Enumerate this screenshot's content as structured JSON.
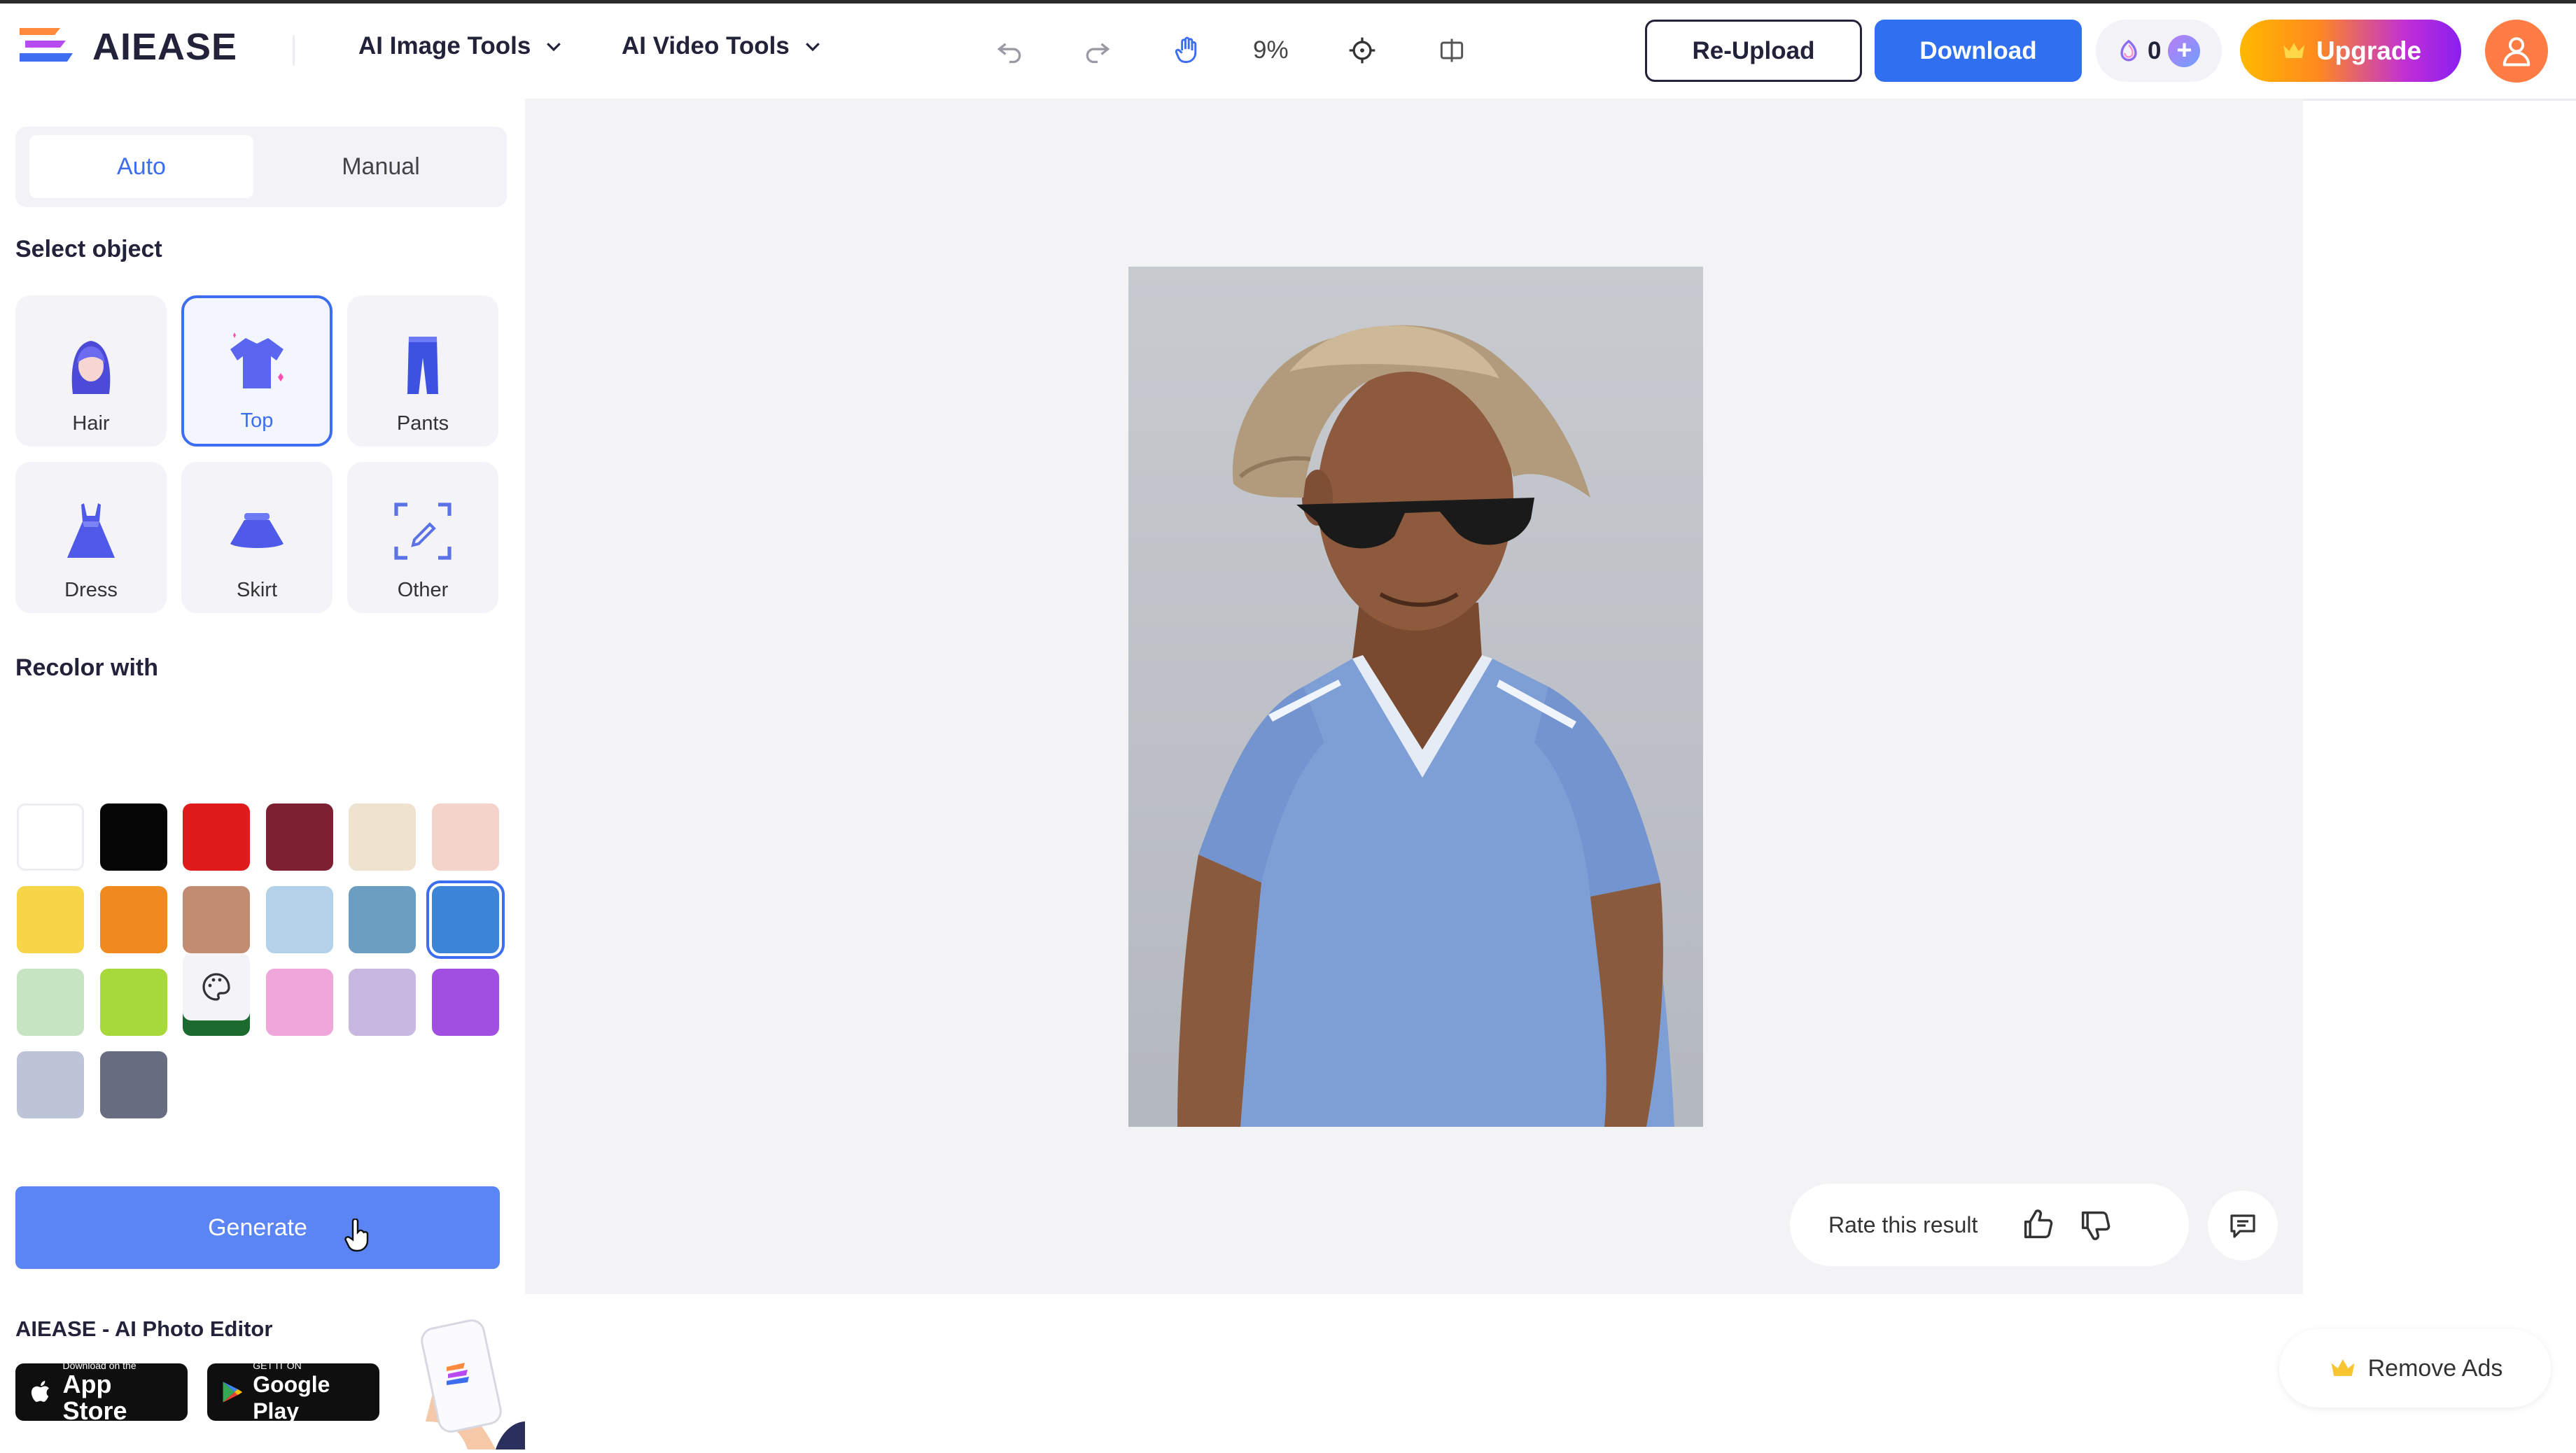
{
  "header": {
    "logo_text": "AIEASE",
    "nav": [
      {
        "label": "AI Image Tools",
        "icon": "chevron-down-icon"
      },
      {
        "label": "AI Video Tools",
        "icon": "chevron-down-icon"
      }
    ],
    "toolbar": {
      "undo_icon": "undo-icon",
      "redo_icon": "redo-icon",
      "pan_icon": "hand-icon",
      "zoom": "9%",
      "recenter_icon": "crosshair-icon",
      "compare_icon": "compare-icon"
    },
    "reupload_label": "Re-Upload",
    "download_label": "Download",
    "credits": "0",
    "upgrade_label": "Upgrade"
  },
  "sidebar": {
    "tabs": [
      {
        "label": "Auto",
        "active": true
      },
      {
        "label": "Manual",
        "active": false
      }
    ],
    "select_title": "Select object",
    "objects": [
      {
        "label": "Hair",
        "icon": "hair-icon",
        "selected": false
      },
      {
        "label": "Top",
        "icon": "shirt-icon",
        "selected": true
      },
      {
        "label": "Pants",
        "icon": "pants-icon",
        "selected": false
      },
      {
        "label": "Dress",
        "icon": "dress-icon",
        "selected": false
      },
      {
        "label": "Skirt",
        "icon": "skirt-icon",
        "selected": false
      },
      {
        "label": "Other",
        "icon": "select-area-icon",
        "selected": false
      }
    ],
    "recolor_title": "Recolor with",
    "colors": [
      "#ffffff",
      "#050505",
      "#e01b1b",
      "#7c2032",
      "#efe3d0",
      "#f3d3ca",
      "#f6d548",
      "#f08a1e",
      "#c28c73",
      "#b3d2ea",
      "#6b9ec1",
      "#3c84d8",
      "#c6e3c2",
      "#a7d93a",
      "#1c6a2f",
      "#f0a6d8",
      "#c6b8e0",
      "#a14fe0",
      "#bec4d8",
      "#686c80"
    ],
    "selected_color": "#3c84d8",
    "custom_color_icon": "palette-icon",
    "generate_label": "Generate",
    "promo_title": "AIEASE - AI Photo Editor",
    "app_store": {
      "small": "Download on the",
      "big": "App Store"
    },
    "google_play": {
      "small": "GET IT ON",
      "big": "Google Play"
    }
  },
  "canvas": {
    "rate_label": "Rate this result"
  },
  "remove_ads_label": "Remove Ads"
}
